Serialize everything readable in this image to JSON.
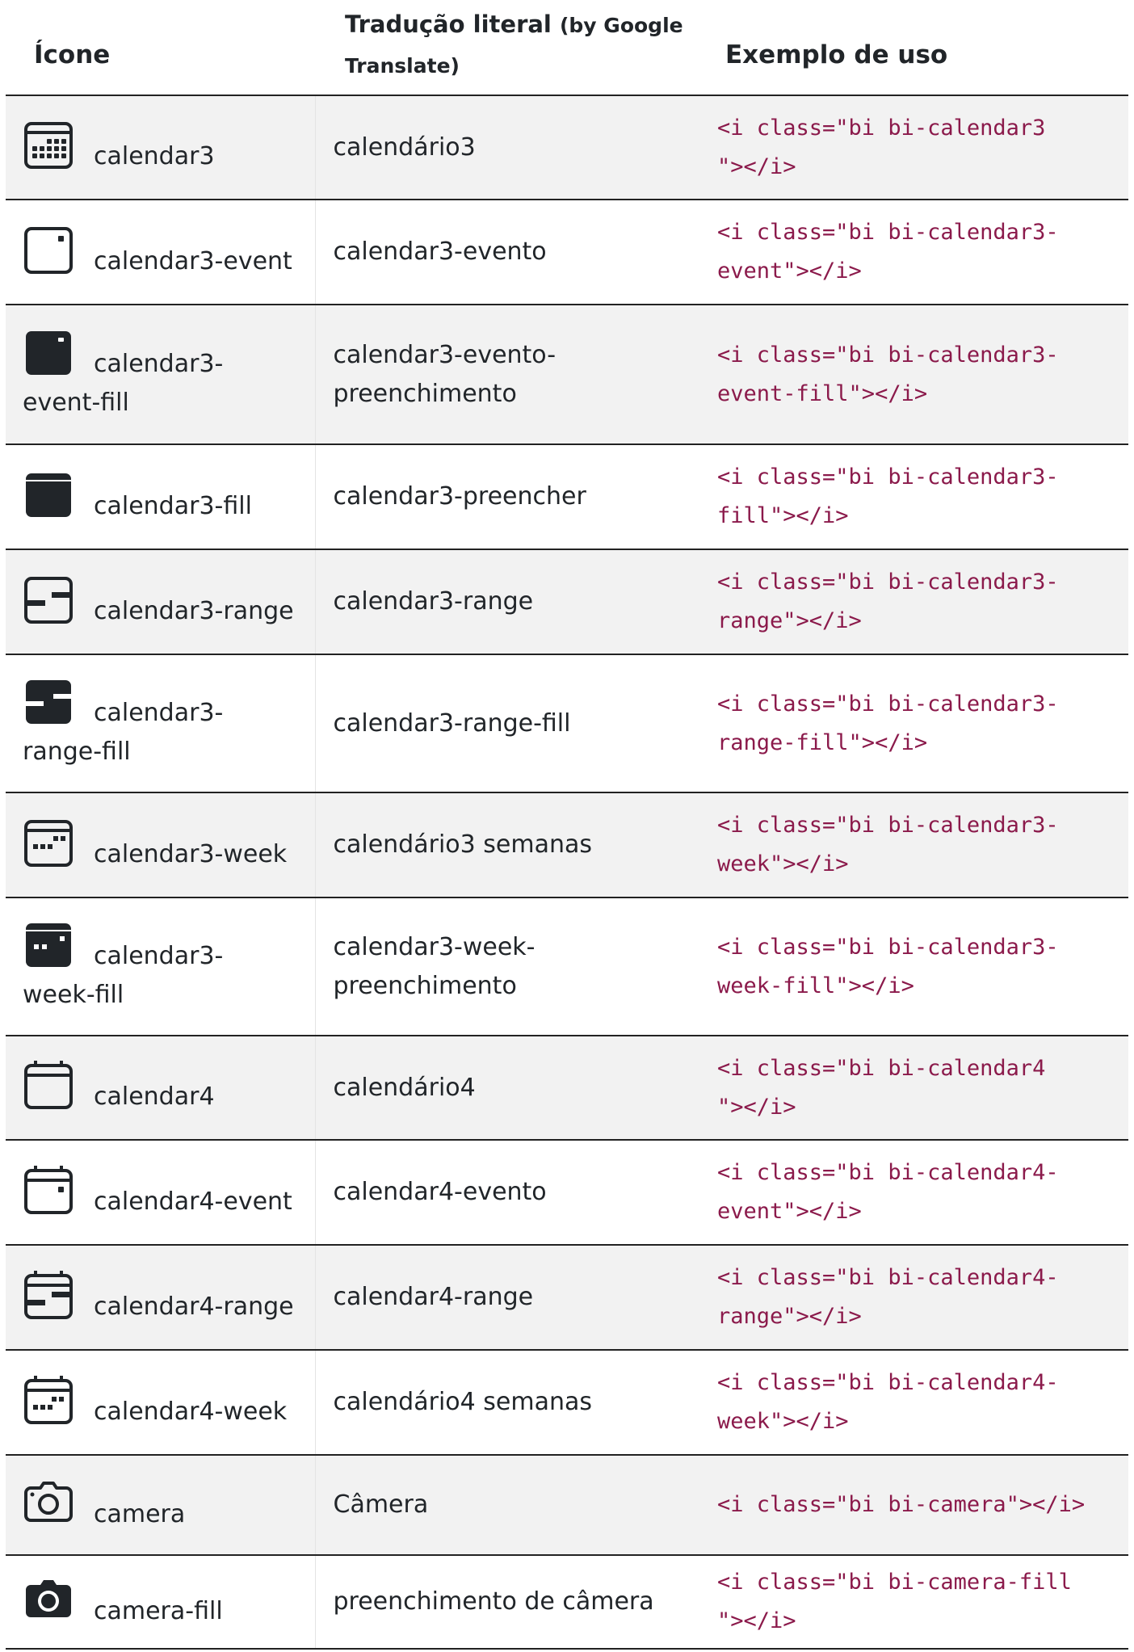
{
  "headers": {
    "icon": "Ícone",
    "translation_main": "Tradução literal",
    "translation_note": "(by Google Translate)",
    "usage": "Exemplo de uso"
  },
  "rows": [
    {
      "icon": "calendar3-icon",
      "name": "calendar3",
      "translation": "calendário3",
      "code": "<i class=\"bi bi-calendar3\"></i>"
    },
    {
      "icon": "calendar3-event-icon",
      "name": "calendar3-event",
      "translation": "calendar3-evento",
      "code": "<i class=\"bi bi-calendar3-event\"></i>"
    },
    {
      "icon": "calendar3-event-fill-icon",
      "name": "calendar3-event-fill",
      "translation": "calendar3-evento-preenchimento",
      "code": "<i class=\"bi bi-calendar3-event-fill\"></i>"
    },
    {
      "icon": "calendar3-fill-icon",
      "name": "calendar3-fill",
      "translation": "calendar3-preencher",
      "code": "<i class=\"bi bi-calendar3-fill\"></i>"
    },
    {
      "icon": "calendar3-range-icon",
      "name": "calendar3-range",
      "translation": "calendar3-range",
      "code": "<i class=\"bi bi-calendar3-range\"></i>"
    },
    {
      "icon": "calendar3-range-fill-icon",
      "name": "calendar3-range-fill",
      "translation": "calendar3-range-fill",
      "code": "<i class=\"bi bi-calendar3-range-fill\"></i>"
    },
    {
      "icon": "calendar3-week-icon",
      "name": "calendar3-week",
      "translation": "calendário3 semanas",
      "code": "<i class=\"bi bi-calendar3-week\"></i>"
    },
    {
      "icon": "calendar3-week-fill-icon",
      "name": "calendar3-week-fill",
      "translation": "calendar3-week-preenchimento",
      "code": "<i class=\"bi bi-calendar3-week-fill\"></i>"
    },
    {
      "icon": "calendar4-icon",
      "name": "calendar4",
      "translation": "calendário4",
      "code": "<i class=\"bi bi-calendar4\"></i>"
    },
    {
      "icon": "calendar4-event-icon",
      "name": "calendar4-event",
      "translation": "calendar4-evento",
      "code": "<i class=\"bi bi-calendar4-event\"></i>"
    },
    {
      "icon": "calendar4-range-icon",
      "name": "calendar4-range",
      "translation": "calendar4-range",
      "code": "<i class=\"bi bi-calendar4-range\"></i>"
    },
    {
      "icon": "calendar4-week-icon",
      "name": "calendar4-week",
      "translation": "calendário4 semanas",
      "code": "<i class=\"bi bi-calendar4-week\"></i>"
    },
    {
      "icon": "camera-icon",
      "name": "camera",
      "translation": "Câmera",
      "code": "<i class=\"bi bi-camera\"></i>"
    },
    {
      "icon": "camera-fill-icon",
      "name": "camera-fill",
      "translation": "preenchimento de câmera",
      "code": "<i class=\"bi bi-camera-fill\"></i>"
    }
  ]
}
